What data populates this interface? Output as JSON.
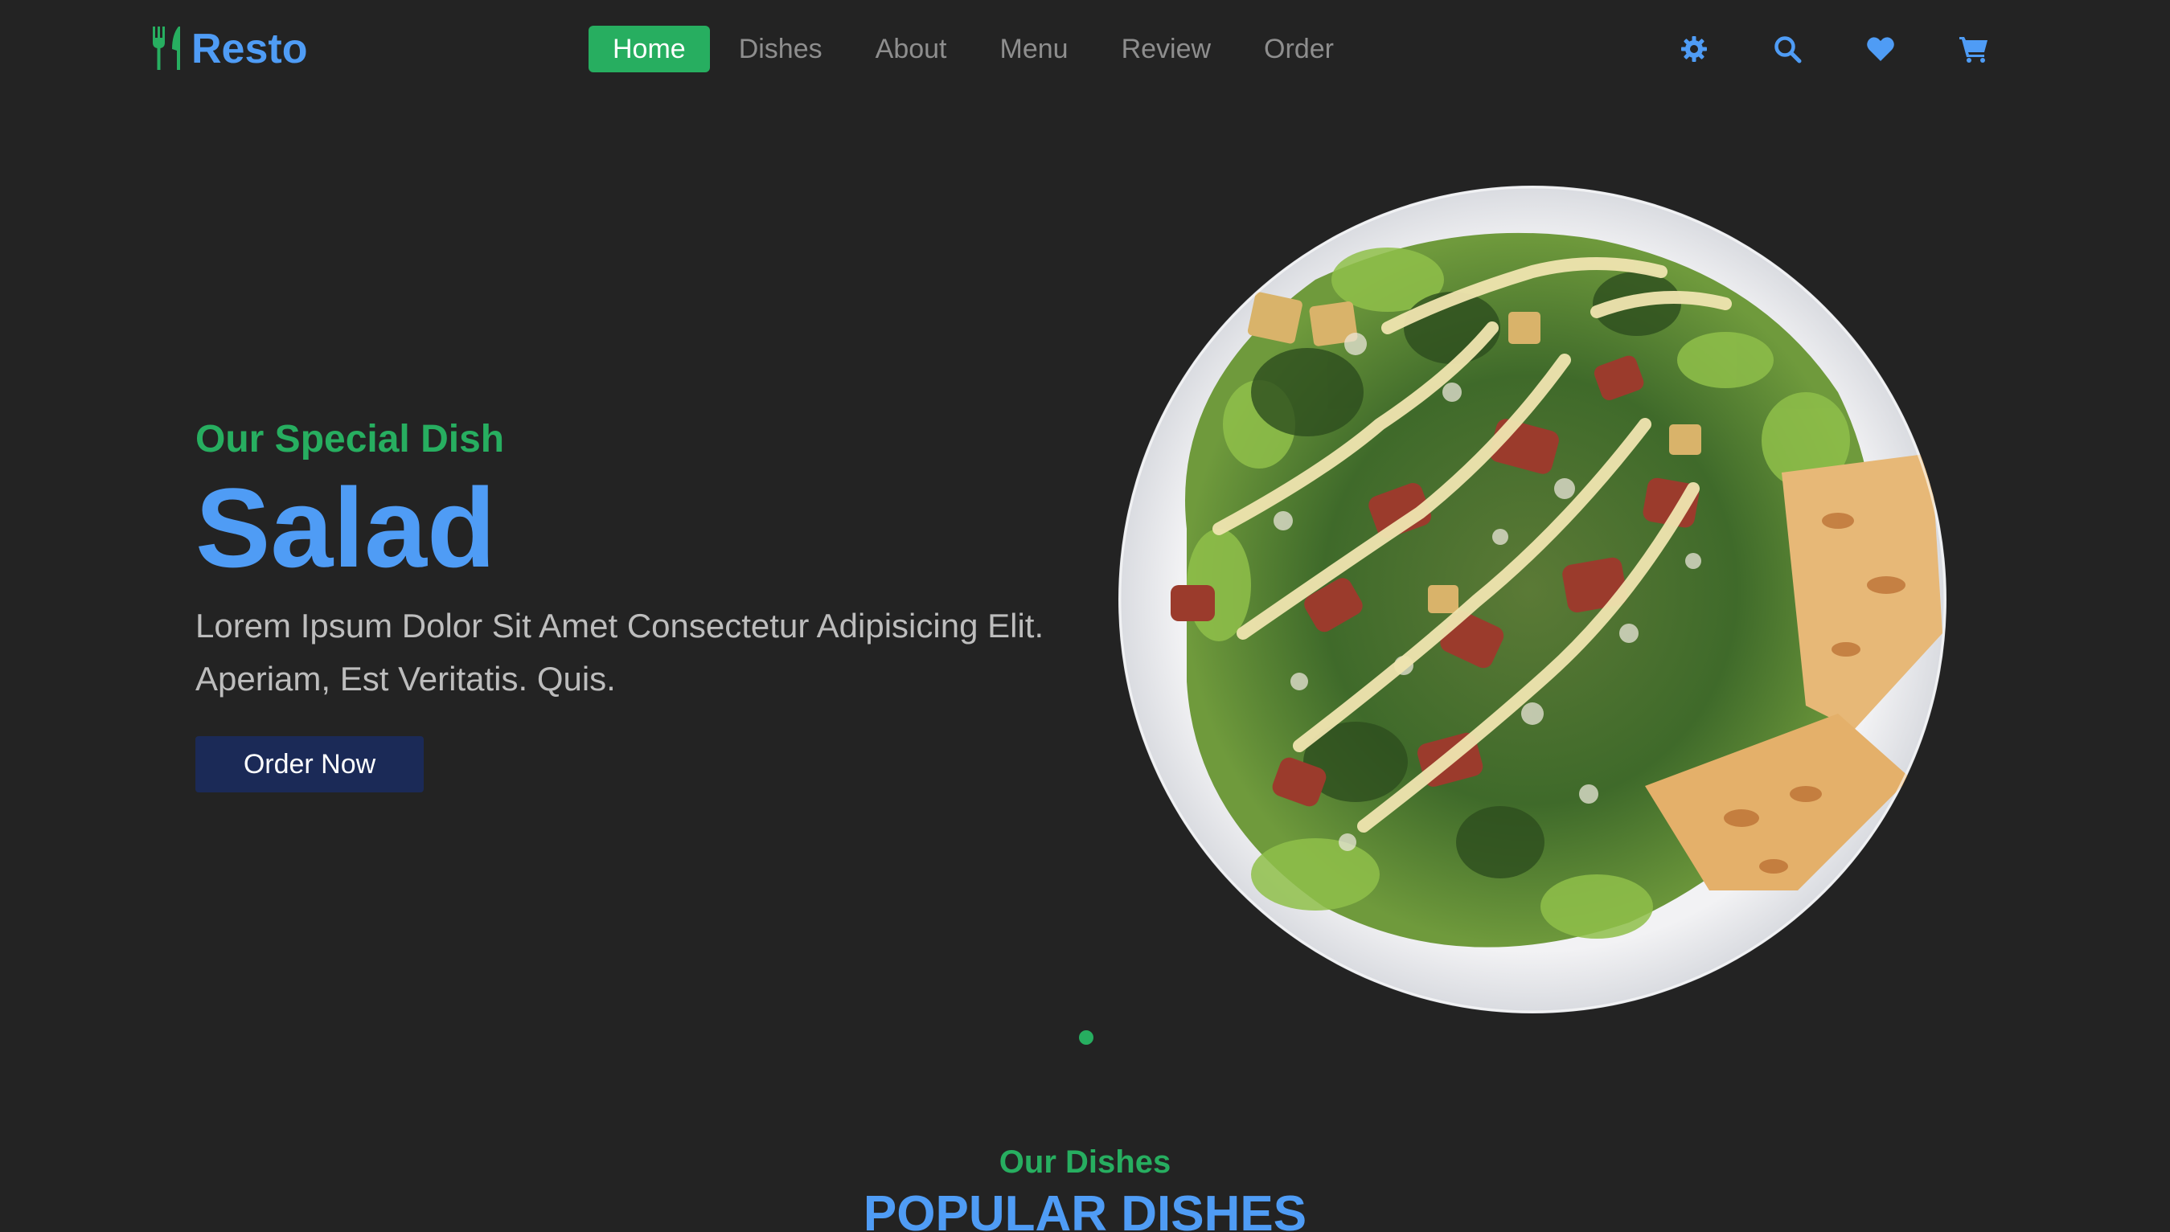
{
  "brand": {
    "name": "Resto",
    "icon": "utensils-icon",
    "color": "#4f9cf5",
    "accent": "#27ae60"
  },
  "nav": {
    "items": [
      "Home",
      "Dishes",
      "About",
      "Menu",
      "Review",
      "Order"
    ],
    "active": "Home"
  },
  "header_icons": [
    "gear-icon",
    "search-icon",
    "heart-icon",
    "cart-icon"
  ],
  "hero": {
    "subtitle": "Our Special Dish",
    "title": "Salad",
    "description": "Lorem Ipsum Dolor Sit Amet Consectetur Adipisicing Elit. Aperiam, Est Veritatis. Quis.",
    "button_label": "Order Now",
    "button_color": "#1b2a57",
    "slider_dots": 1,
    "active_dot": 1
  },
  "dishes_section": {
    "subtitle": "Our Dishes",
    "title": "POPULAR DISHES"
  },
  "colors": {
    "background": "#232323",
    "primary_blue": "#4f9cf5",
    "green": "#27ae60",
    "muted_text": "#8e8e8e"
  }
}
